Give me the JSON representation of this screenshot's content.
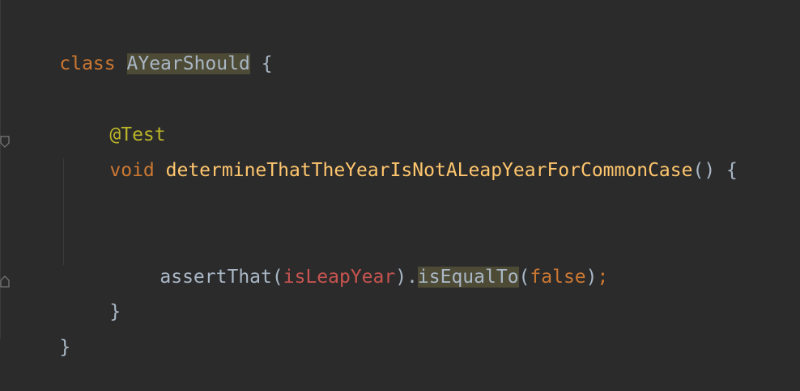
{
  "code": {
    "line1": {
      "keyword": "class",
      "class_name": "AYearShould",
      "brace": "{"
    },
    "line2": {
      "annotation": "@Test"
    },
    "line3": {
      "keyword": "void",
      "method_name": "determineThatTheYearIsNotALeapYearForCommonCase",
      "parens": "()",
      "brace": "{"
    },
    "line4": {
      "call": "assertThat",
      "open_paren": "(",
      "argument": "isLeapYear",
      "close_dot": ").",
      "chained_call": "isEqualTo",
      "open_paren2": "(",
      "literal": "false",
      "close_paren": ")",
      "semicolon": ";"
    },
    "line5": {
      "brace": "}"
    },
    "line6": {
      "brace": "}"
    }
  },
  "colors": {
    "background": "#2b2b2b",
    "keyword": "#cc7832",
    "annotation": "#bbb529",
    "method": "#ffc66d",
    "variable": "#c75450",
    "text": "#a9b7c6",
    "highlight": "#4d4a35"
  }
}
